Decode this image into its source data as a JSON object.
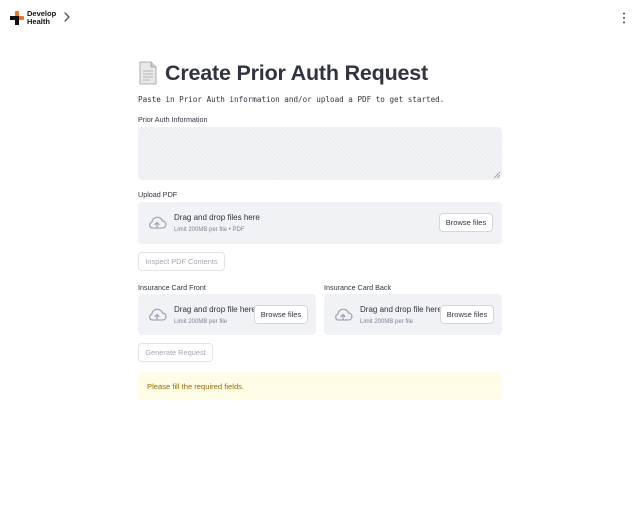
{
  "header": {
    "logo_line1": "Develop",
    "logo_line2": "Health"
  },
  "colors": {
    "brand_orange": "#e8772e",
    "dropzone_bg": "#f0f2f6",
    "warning_bg": "#fffce7",
    "warning_text": "#926c05"
  },
  "icons": {
    "title": "document-icon",
    "upload": "cloud-upload-icon",
    "sidebar_toggle": "chevron-right-icon",
    "menu": "vertical-dots-icon"
  },
  "main": {
    "title": "Create Prior Auth Request",
    "subtitle": "Paste in Prior Auth information and/or upload a PDF to get started.",
    "prior_auth": {
      "label": "Prior Auth Information",
      "value": ""
    },
    "upload_pdf": {
      "label": "Upload PDF",
      "drop_text": "Drag and drop files here",
      "limit_text": "Limit 200MB per file • PDF",
      "browse_label": "Browse files"
    },
    "inspect_button": "Inspect PDF Contents",
    "card_front": {
      "label": "Insurance Card Front",
      "drop_text": "Drag and drop file here",
      "limit_text": "Limit 200MB per file",
      "browse_label": "Browse files"
    },
    "card_back": {
      "label": "Insurance Card Back",
      "drop_text": "Drag and drop file here",
      "limit_text": "Limit 200MB per file",
      "browse_label": "Browse files"
    },
    "generate_button": "Generate Request",
    "alert": "Please fill the required fields."
  }
}
